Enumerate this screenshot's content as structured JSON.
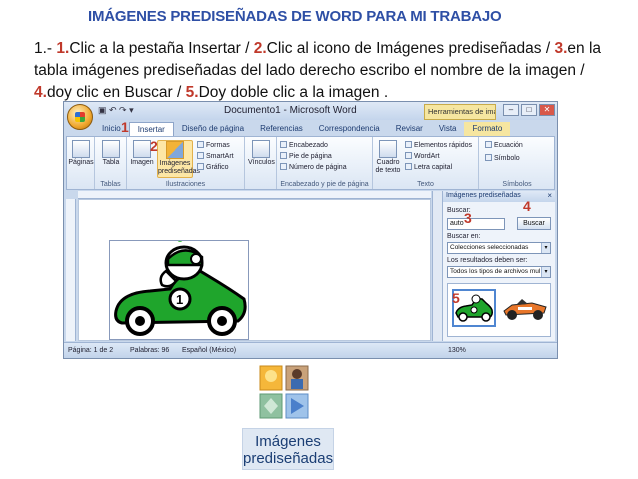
{
  "heading": "IMÁGENES PREDISEÑADAS DE WORD PARA MI TRABAJO",
  "instructions": {
    "prefix": "1.-",
    "s1_num": "1.",
    "s1_text": "Clic a la pestaña Insertar /",
    "s2_num": "2.",
    "s2_text": "Clic al icono de Imágenes prediseñadas /",
    "s3_num": "3.",
    "s3_text": "en la tabla imágenes prediseñadas del lado derecho escribo el nombre de la imagen /",
    "s4_num": "4.",
    "s4_text": "doy clic en Buscar /",
    "s5_num": "5.",
    "s5_text": "Doy doble clic a la imagen ."
  },
  "word": {
    "window_title": "Documento1 - Microsoft Word",
    "context_tool": "Herramientas de imag...",
    "win_min": "–",
    "win_max": "□",
    "win_close": "✕",
    "tabs": [
      "Inicio",
      "Insertar",
      "Diseño de página",
      "Referencias",
      "Correspondencia",
      "Revisar",
      "Vista",
      "Formato"
    ],
    "ribbon": {
      "paginas": "Páginas",
      "tabla": "Tabla",
      "imagen": "Imagen",
      "imagenes_predisenadas_1": "Imágenes",
      "imagenes_predisenadas_2": "prediseñadas",
      "formas": "Formas",
      "smartart": "SmartArt",
      "grafico": "Gráfico",
      "vinculos": "Vínculos",
      "encabezado": "Encabezado",
      "pie_de_pagina": "Pie de página",
      "numero_de_pagina": "Número de página",
      "cuadro_de_texto_1": "Cuadro",
      "cuadro_de_texto_2": "de texto",
      "elementos_rapidos": "Elementos rápidos",
      "wordart": "WordArt",
      "letra_capital": "Letra capital",
      "ecuacion": "Ecuación",
      "simbolo": "Símbolo",
      "group_tablas": "Tablas",
      "group_ilustraciones": "Ilustraciones",
      "group_encabezado": "Encabezado y pie de página",
      "group_texto": "Texto",
      "group_simbolos": "Símbolos"
    },
    "pane": {
      "title": "Imágenes prediseñadas",
      "close": "×",
      "buscar_label": "Buscar:",
      "search_value": "auto",
      "search_button": "Buscar",
      "buscar_en_label": "Buscar en:",
      "buscar_en_value": "Colecciones seleccionadas",
      "resultados_label": "Los resultados deben ser:",
      "resultados_value": "Todos los tipos de archivos mul"
    },
    "status": {
      "pagina": "Página: 1 de 2",
      "palabras": "Palabras: 96",
      "idioma": "Español (México)",
      "zoom": "130%"
    }
  },
  "markers": [
    "1",
    "2",
    "3",
    "4",
    "5"
  ],
  "zoom_label_1": "Imágenes",
  "zoom_label_2": "prediseñadas",
  "colors": {
    "heading": "#2e4fa5",
    "step_number": "#c0392b",
    "car_green": "#1fa52c"
  },
  "icons": [
    "office-button-icon",
    "clipart-icon",
    "car-clipart-icon",
    "race-car-icon",
    "close-icon",
    "dropdown-arrow-icon"
  ]
}
